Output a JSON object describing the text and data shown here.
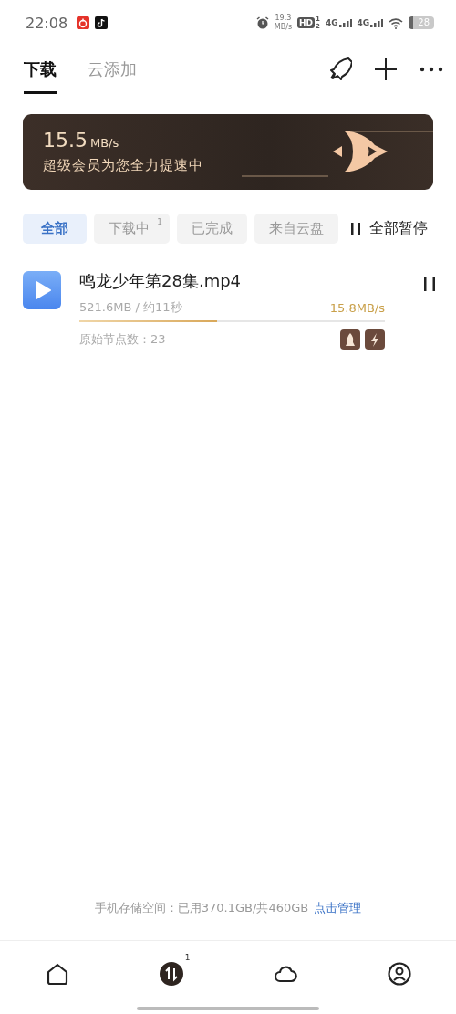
{
  "status_bar": {
    "time": "22:08",
    "net_speed": "19.3",
    "net_unit": "MB/s",
    "hd": "HD",
    "hd_sims": [
      "1",
      "2"
    ],
    "networks": [
      "4G",
      "4G"
    ],
    "battery": "28"
  },
  "tabs": [
    {
      "label": "下载",
      "selected": true
    },
    {
      "label": "云添加",
      "selected": false
    }
  ],
  "banner": {
    "speed": "15.5",
    "unit": "MB/s",
    "message": "超级会员为您全力提速中"
  },
  "filters": [
    {
      "label": "全部",
      "selected": true
    },
    {
      "label": "下载中",
      "badge": "1",
      "selected": false
    },
    {
      "label": "已完成",
      "selected": false
    },
    {
      "label": "来自云盘",
      "selected": false
    }
  ],
  "pause_all": {
    "label": "全部暂停"
  },
  "tasks": [
    {
      "name": "鸣龙少年第28集.mp4",
      "size_eta": "521.6MB / 约11秒",
      "speed": "15.8MB/s",
      "level": 0.45,
      "nodes": "原始节点数：23"
    }
  ],
  "storage": {
    "text": "手机存储空间：已用370.1GB/共460GB",
    "link": "点击管理"
  },
  "nav": [
    {
      "kind": "home",
      "selected": false
    },
    {
      "kind": "transfer",
      "badge": "1",
      "selected": true
    },
    {
      "kind": "cloud",
      "selected": false
    },
    {
      "kind": "profile",
      "selected": false
    }
  ]
}
